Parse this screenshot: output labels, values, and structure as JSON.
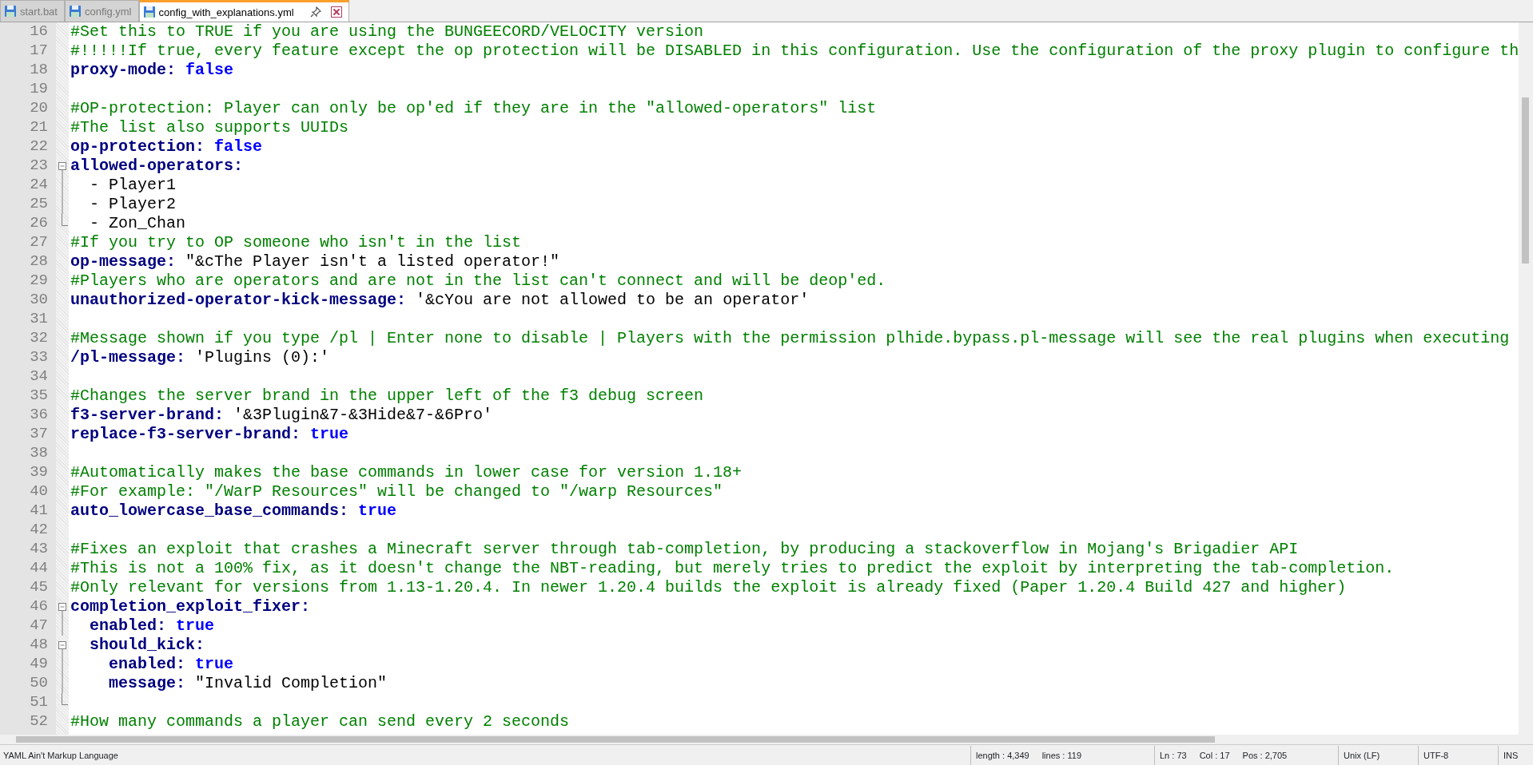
{
  "tabs": [
    {
      "label": "start.bat",
      "selected": false
    },
    {
      "label": "config.yml",
      "selected": false
    },
    {
      "label": "config_with_explanations.yml",
      "selected": true
    }
  ],
  "editor": {
    "lines": [
      {
        "number": "16",
        "kind": "plain",
        "segments": [
          {
            "kind": "comment",
            "text": "#Set this to TRUE if you are using the BUNGEECORD/VELOCITY version"
          }
        ]
      },
      {
        "number": "17",
        "kind": "plain",
        "segments": [
          {
            "kind": "comment",
            "text": "#!!!!!If true, every feature except the op protection will be DISABLED in this configuration. Use the configuration of the proxy plugin to configure th"
          }
        ]
      },
      {
        "number": "18",
        "kind": "plain",
        "segments": [
          {
            "kind": "key",
            "text": "proxy-mode:"
          },
          {
            "kind": "bool",
            "text": " false"
          }
        ]
      },
      {
        "number": "19",
        "kind": "plain"
      },
      {
        "number": "20",
        "kind": "plain",
        "segments": [
          {
            "kind": "comment",
            "text": "#OP-protection: Player can only be op'ed if they are in the \"allowed-operators\" list"
          }
        ]
      },
      {
        "number": "21",
        "kind": "plain",
        "segments": [
          {
            "kind": "comment",
            "text": "#The list also supports UUIDs"
          }
        ]
      },
      {
        "number": "22",
        "kind": "plain",
        "segments": [
          {
            "kind": "key",
            "text": "op-protection:"
          },
          {
            "kind": "bool",
            "text": " false"
          }
        ]
      },
      {
        "number": "23",
        "kind": "opener",
        "segments": [
          {
            "kind": "key",
            "text": "allowed-operators:"
          }
        ]
      },
      {
        "number": "24",
        "kind": "inside",
        "segments": [
          {
            "kind": "plain",
            "text": "  - Player1"
          }
        ]
      },
      {
        "number": "25",
        "kind": "inside",
        "segments": [
          {
            "kind": "plain",
            "text": "  - Player2"
          }
        ]
      },
      {
        "number": "26",
        "kind": "closer",
        "segments": [
          {
            "kind": "plain",
            "text": "  - Zon_Chan"
          }
        ]
      },
      {
        "number": "27",
        "kind": "plain",
        "segments": [
          {
            "kind": "comment",
            "text": "#If you try to OP someone who isn't in the list"
          }
        ]
      },
      {
        "number": "28",
        "kind": "plain",
        "segments": [
          {
            "kind": "key",
            "text": "op-message:"
          },
          {
            "kind": "plain",
            "text": " \"&cThe Player isn't a listed operator!\""
          }
        ]
      },
      {
        "number": "29",
        "kind": "plain",
        "segments": [
          {
            "kind": "comment",
            "text": "#Players who are operators and are not in the list can't connect and will be deop'ed."
          }
        ]
      },
      {
        "number": "30",
        "kind": "plain",
        "segments": [
          {
            "kind": "key",
            "text": "unauthorized-operator-kick-message:"
          },
          {
            "kind": "plain",
            "text": " '&cYou are not allowed to be an operator'"
          }
        ]
      },
      {
        "number": "31",
        "kind": "plain"
      },
      {
        "number": "32",
        "kind": "plain",
        "segments": [
          {
            "kind": "comment",
            "text": "#Message shown if you type /pl | Enter none to disable | Players with the permission plhide.bypass.pl-message will see the real plugins when executing"
          }
        ]
      },
      {
        "number": "33",
        "kind": "plain",
        "segments": [
          {
            "kind": "key",
            "text": "/pl-message:"
          },
          {
            "kind": "plain",
            "text": " 'Plugins (0):'"
          }
        ]
      },
      {
        "number": "34",
        "kind": "plain"
      },
      {
        "number": "35",
        "kind": "plain",
        "segments": [
          {
            "kind": "comment",
            "text": "#Changes the server brand in the upper left of the f3 debug screen"
          }
        ]
      },
      {
        "number": "36",
        "kind": "plain",
        "segments": [
          {
            "kind": "key",
            "text": "f3-server-brand:"
          },
          {
            "kind": "plain",
            "text": " '&3Plugin&7-&3Hide&7-&6Pro'"
          }
        ]
      },
      {
        "number": "37",
        "kind": "plain",
        "segments": [
          {
            "kind": "key",
            "text": "replace-f3-server-brand:"
          },
          {
            "kind": "bool",
            "text": " true"
          }
        ]
      },
      {
        "number": "38",
        "kind": "plain"
      },
      {
        "number": "39",
        "kind": "plain",
        "segments": [
          {
            "kind": "comment",
            "text": "#Automatically makes the base commands in lower case for version 1.18+"
          }
        ]
      },
      {
        "number": "40",
        "kind": "plain",
        "segments": [
          {
            "kind": "comment",
            "text": "#For example: \"/WarP Resources\" will be changed to \"/warp Resources\""
          }
        ]
      },
      {
        "number": "41",
        "kind": "plain",
        "segments": [
          {
            "kind": "key",
            "text": "auto_lowercase_base_commands:"
          },
          {
            "kind": "bool",
            "text": " true"
          }
        ]
      },
      {
        "number": "42",
        "kind": "plain"
      },
      {
        "number": "43",
        "kind": "plain",
        "segments": [
          {
            "kind": "comment",
            "text": "#Fixes an exploit that crashes a Minecraft server through tab-completion, by producing a stackoverflow in Mojang's Brigadier API"
          }
        ]
      },
      {
        "number": "44",
        "kind": "plain",
        "segments": [
          {
            "kind": "comment",
            "text": "#This is not a 100% fix, as it doesn't change the NBT-reading, but merely tries to predict the exploit by interpreting the tab-completion."
          }
        ]
      },
      {
        "number": "45",
        "kind": "plain",
        "segments": [
          {
            "kind": "comment",
            "text": "#Only relevant for versions from 1.13-1.20.4. In newer 1.20.4 builds the exploit is already fixed (Paper 1.20.4 Build 427 and higher)"
          }
        ]
      },
      {
        "number": "46",
        "kind": "opener",
        "segments": [
          {
            "kind": "key",
            "text": "completion_exploit_fixer:"
          }
        ]
      },
      {
        "number": "47",
        "kind": "inside",
        "segments": [
          {
            "kind": "key",
            "text": "  enabled:"
          },
          {
            "kind": "bool",
            "text": " true"
          }
        ]
      },
      {
        "number": "48",
        "kind": "opener",
        "segments": [
          {
            "kind": "key",
            "text": "  should_kick:"
          }
        ]
      },
      {
        "number": "49",
        "kind": "inside",
        "segments": [
          {
            "kind": "key",
            "text": "    enabled:"
          },
          {
            "kind": "bool",
            "text": " true"
          }
        ]
      },
      {
        "number": "50",
        "kind": "inside",
        "segments": [
          {
            "kind": "key",
            "text": "    message:"
          },
          {
            "kind": "plain",
            "text": " \"Invalid Completion\""
          }
        ]
      },
      {
        "number": "51",
        "kind": "closer"
      },
      {
        "number": "52",
        "kind": "plain",
        "segments": [
          {
            "kind": "comment",
            "text": "#How many commands a player can send every 2 seconds"
          }
        ]
      }
    ]
  },
  "status_bar": {
    "language": "YAML Ain't Markup Language",
    "length": "length : 4,349",
    "lines": "lines : 119",
    "ln": "Ln : 73",
    "col": "Col : 17",
    "pos": "Pos : 2,705",
    "eol": "Unix (LF)",
    "encoding": "UTF-8",
    "mode": "INS"
  }
}
